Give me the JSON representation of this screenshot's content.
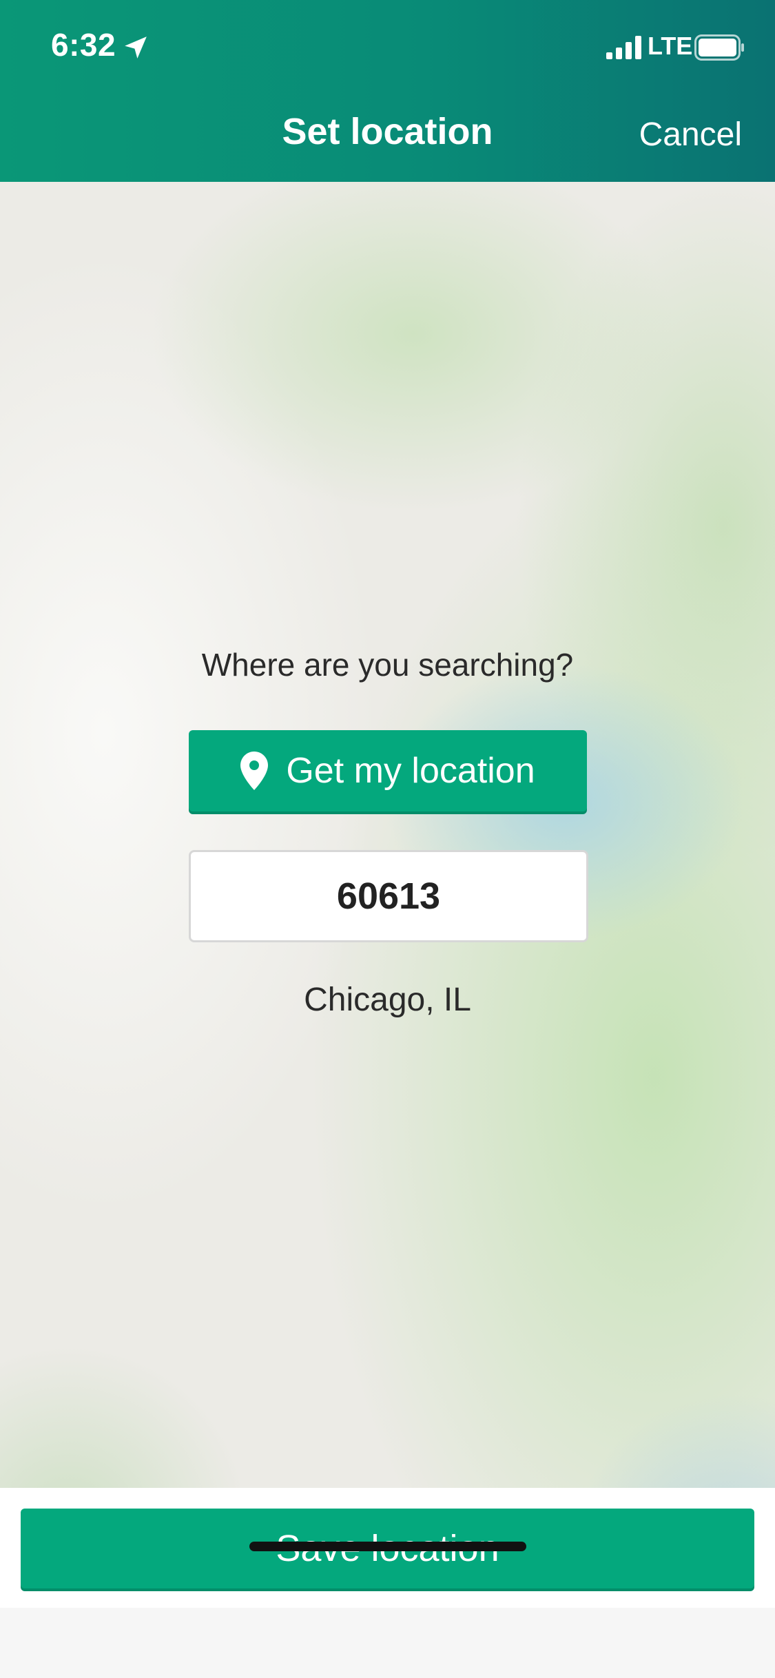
{
  "status_bar": {
    "time": "6:32",
    "network": "LTE"
  },
  "nav": {
    "title": "Set location",
    "cancel_label": "Cancel"
  },
  "main": {
    "question": "Where are you searching?",
    "get_location_label": "Get my location",
    "zip_value": "60613",
    "city": "Chicago, IL"
  },
  "footer": {
    "save_label": "Save location"
  },
  "colors": {
    "header_green": "#098b77",
    "button_green": "#04a87d"
  },
  "icons": [
    "location-arrow-icon",
    "signal-icon",
    "battery-icon",
    "map-pin-icon"
  ]
}
